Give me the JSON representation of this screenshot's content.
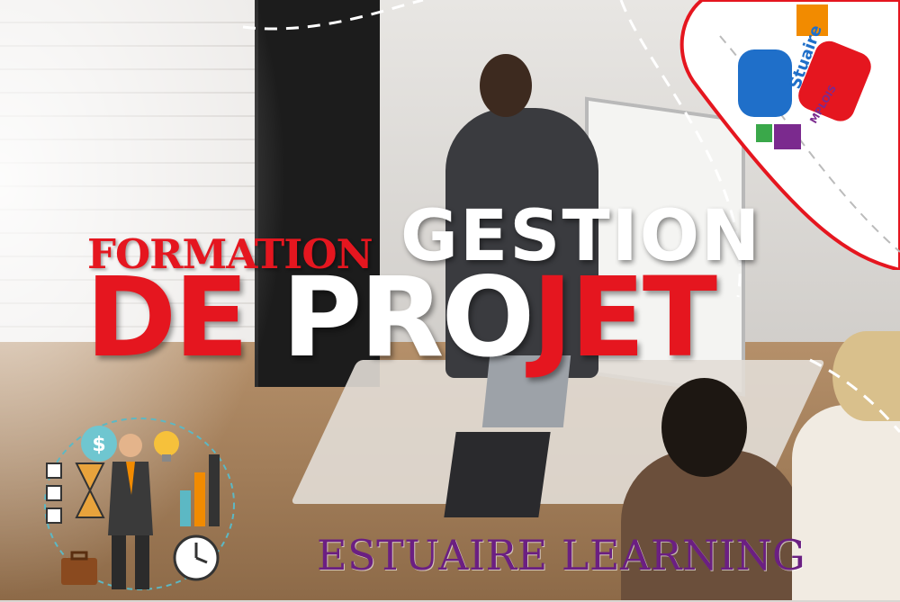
{
  "headline": {
    "word1": "FORMATION",
    "word2": "GESTION",
    "line2_part1": "DE",
    "line2_part2": "PRO",
    "line2_part3": "JET"
  },
  "logo": {
    "brand": "Stuaire",
    "sub": "MPLOIS",
    "colors": {
      "orange": "#f28b00",
      "blue": "#1f6fc9",
      "red": "#e5161f",
      "purple": "#7b2a8e",
      "green": "#3aa84a"
    }
  },
  "footer": {
    "brand": "ESTUAIRE LEARNING"
  },
  "colors": {
    "accent_red": "#e5161f",
    "footer_purple": "#6b1f82",
    "white": "#ffffff"
  },
  "illustration": {
    "icons": [
      "checklist-icon",
      "dollar-icon",
      "lightbulb-icon",
      "bar-chart-icon",
      "hourglass-icon",
      "businessman-icon",
      "clock-icon",
      "briefcase-icon"
    ]
  }
}
